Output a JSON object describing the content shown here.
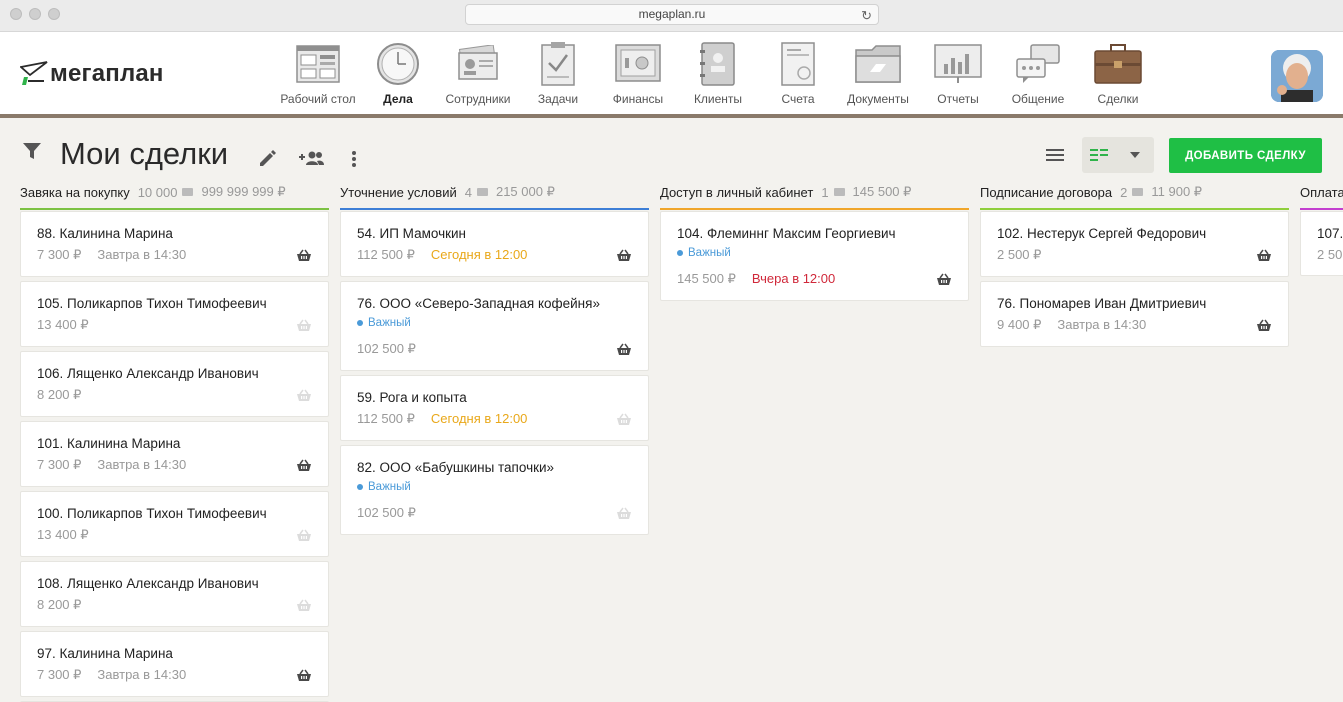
{
  "browser": {
    "url": "megaplan.ru"
  },
  "logo": {
    "text": "мегаплан"
  },
  "nav": [
    {
      "label": "Рабочий стол",
      "icon": "desktop-icon",
      "active": false
    },
    {
      "label": "Дела",
      "icon": "clock-icon",
      "active": true
    },
    {
      "label": "Сотрудники",
      "icon": "employees-icon",
      "active": false
    },
    {
      "label": "Задачи",
      "icon": "tasks-icon",
      "active": false
    },
    {
      "label": "Финансы",
      "icon": "safe-icon",
      "active": false
    },
    {
      "label": "Клиенты",
      "icon": "address-book-icon",
      "active": false
    },
    {
      "label": "Счета",
      "icon": "invoice-icon",
      "active": false
    },
    {
      "label": "Документы",
      "icon": "folder-icon",
      "active": false
    },
    {
      "label": "Отчеты",
      "icon": "report-icon",
      "active": false
    },
    {
      "label": "Общение",
      "icon": "chat-icon",
      "active": false
    },
    {
      "label": "Сделки",
      "icon": "briefcase-icon",
      "active": false
    }
  ],
  "page": {
    "title": "Мои сделки",
    "add_button": "ДОБАВИТЬ СДЕЛКУ"
  },
  "columns": [
    {
      "title": "Завяка на покупку",
      "count": "10 000",
      "total": "999 999 999 ₽",
      "color": "#7cc243",
      "cards": [
        {
          "title": "88.  Калинина Марина",
          "amount": "7 300 ₽",
          "due": "Завтра в 14:30",
          "due_status": "normal",
          "basket": "active"
        },
        {
          "title": "105.  Поликарпов Тихон Тимофеевич",
          "amount": "13 400 ₽",
          "due": "",
          "due_status": "normal",
          "basket": "inactive"
        },
        {
          "title": "106.  Лященко Александр Иванович",
          "amount": "8 200 ₽",
          "due": "",
          "due_status": "normal",
          "basket": "inactive"
        },
        {
          "title": "101.   Калинина Марина",
          "amount": "7 300 ₽",
          "due": "Завтра в 14:30",
          "due_status": "normal",
          "basket": "active"
        },
        {
          "title": "100.  Поликарпов Тихон Тимофеевич",
          "amount": "13 400 ₽",
          "due": "",
          "due_status": "normal",
          "basket": "inactive"
        },
        {
          "title": "108.  Лященко Александр Иванович",
          "amount": "8 200 ₽",
          "due": "",
          "due_status": "normal",
          "basket": "inactive"
        },
        {
          "title": "97.  Калинина Марина",
          "amount": "7 300 ₽",
          "due": "Завтра в 14:30",
          "due_status": "normal",
          "basket": "active"
        },
        {
          "title": "",
          "amount": "",
          "due": "",
          "due_status": "normal",
          "basket": "none"
        }
      ]
    },
    {
      "title": "Уточнение условий",
      "count": "4",
      "total": "215 000 ₽",
      "color": "#3d7fd6",
      "cards": [
        {
          "title": "54.  ИП Мамочкин",
          "amount": "112 500 ₽",
          "due": "Сегодня в 12:00",
          "due_status": "today",
          "basket": "active"
        },
        {
          "title": "76.  ООО «Северо-Западная кофейня»",
          "tag": "Важный",
          "amount": "102 500 ₽",
          "due": "",
          "due_status": "normal",
          "basket": "active"
        },
        {
          "title": "59.  Рога и копыта",
          "amount": "112 500 ₽",
          "due": "Сегодня в 12:00",
          "due_status": "today",
          "basket": "inactive"
        },
        {
          "title": "82.  ООО «Бабушкины тапочки»",
          "tag": "Важный",
          "amount": "102 500 ₽",
          "due": "",
          "due_status": "normal",
          "basket": "inactive"
        }
      ]
    },
    {
      "title": "Доступ в личный кабинет",
      "count": "1",
      "total": "145 500 ₽",
      "color": "#f0a62a",
      "cards": [
        {
          "title": "104.  Флеминнг Максим Георгиевич",
          "tag": "Важный",
          "amount": "145 500 ₽",
          "due": "Вчера в 12:00",
          "due_status": "overdue",
          "basket": "active"
        }
      ]
    },
    {
      "title": "Подписание договора",
      "count": "2",
      "total": "11 900 ₽",
      "color": "#8fcf3c",
      "cards": [
        {
          "title": "102.  Нестерук Сергей Федорович",
          "amount": "2 500 ₽",
          "due": "",
          "due_status": "normal",
          "basket": "active"
        },
        {
          "title": "76.   Пономарев Иван Дмитриевич",
          "amount": "9 400 ₽",
          "due": "Завтра в 14:30",
          "due_status": "normal",
          "basket": "active"
        }
      ]
    },
    {
      "title": "Оплата",
      "count": "",
      "total": "",
      "color": "#c33fcf",
      "cards": [
        {
          "title": "107.",
          "amount": "2 50",
          "due": "",
          "due_status": "normal",
          "basket": "none"
        }
      ]
    }
  ]
}
